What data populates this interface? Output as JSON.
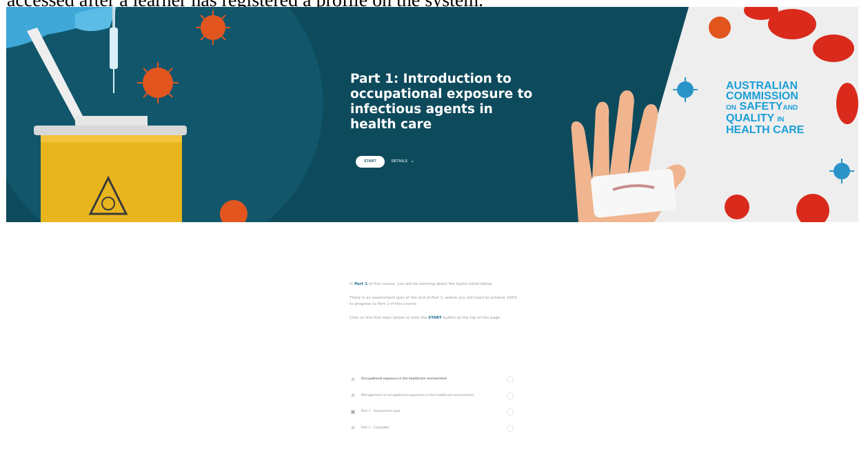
{
  "caption": "accessed after a learner has registered a profile on the system.",
  "hero": {
    "title": "Part 1: Introduction to occupational exposure to infectious agents in health care",
    "start_label": "START",
    "details_label": "DETAILS",
    "brand_lines": [
      "AUSTRALIAN",
      "COMMISSION",
      "ON",
      "SAFETY",
      "AND",
      "QUALITY",
      "IN",
      "HEALTH CARE"
    ],
    "colors": {
      "background": "#0d4a5c",
      "brand": "#1a9ed8",
      "bin": "#e8b51f",
      "virus": "#e2551f"
    }
  },
  "intro": {
    "p1_pre": "In ",
    "p1_hl": "Part 1",
    "p1_post": " of this course, you will be learning about the topics listed below.",
    "p2": "There is an assessment quiz at the end of Part 1, where you will need to achieve 100% to progress to Part 2 of this course.",
    "p3_pre": "Click on the first topic below or click the ",
    "p3_hl": "START",
    "p3_post": " button at the top of this page."
  },
  "topics": [
    {
      "label": "Occupational exposure in the healthcare environment",
      "icon": "lesson-icon"
    },
    {
      "label": "Management of occupational exposures in the healthcare environment",
      "icon": "lesson-icon"
    },
    {
      "label": "Part 1 - Assessment quiz",
      "icon": "quiz-icon"
    },
    {
      "label": "Part 1 - Complete",
      "icon": "lesson-icon"
    }
  ]
}
